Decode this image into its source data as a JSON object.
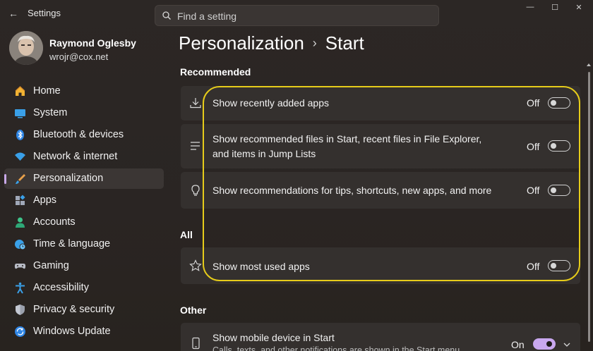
{
  "titlebar": {
    "back_glyph": "←",
    "app_title": "Settings",
    "minimize_glyph": "—",
    "maximize_glyph": "☐",
    "close_glyph": "✕"
  },
  "search": {
    "placeholder": "Find a setting"
  },
  "profile": {
    "name": "Raymond Oglesby",
    "email": "wrojr@cox.net"
  },
  "sidebar": {
    "items": [
      {
        "label": "Home",
        "icon": "home-icon"
      },
      {
        "label": "System",
        "icon": "system-icon"
      },
      {
        "label": "Bluetooth & devices",
        "icon": "bluetooth-icon"
      },
      {
        "label": "Network & internet",
        "icon": "wifi-icon"
      },
      {
        "label": "Personalization",
        "icon": "brush-icon",
        "active": true
      },
      {
        "label": "Apps",
        "icon": "apps-icon"
      },
      {
        "label": "Accounts",
        "icon": "accounts-icon"
      },
      {
        "label": "Time & language",
        "icon": "globe-clock-icon"
      },
      {
        "label": "Gaming",
        "icon": "gamepad-icon"
      },
      {
        "label": "Accessibility",
        "icon": "accessibility-icon"
      },
      {
        "label": "Privacy & security",
        "icon": "shield-icon"
      },
      {
        "label": "Windows Update",
        "icon": "update-icon"
      }
    ]
  },
  "header": {
    "parent": "Personalization",
    "separator": "›",
    "current": "Start"
  },
  "sections": {
    "recommended": "Recommended",
    "all": "All",
    "other": "Other"
  },
  "settings": {
    "recent_apps": {
      "label": "Show recently added apps",
      "state": "Off"
    },
    "recommended_files": {
      "line1": "Show recommended files in Start, recent files in File Explorer,",
      "line2": "and items in Jump Lists",
      "state": "Off"
    },
    "tips": {
      "label": "Show recommendations for tips, shortcuts, new apps, and more",
      "state": "Off"
    },
    "most_used": {
      "label": "Show most used apps",
      "state": "Off"
    },
    "mobile": {
      "label": "Show mobile device in Start",
      "sublabel": "Calls, texts, and other notifications are shown in the Start menu",
      "state": "On"
    }
  },
  "colors": {
    "accent": "#c9a8ef",
    "highlight": "#e6cc1a",
    "card": "#34302e",
    "background": "#2a2523"
  }
}
